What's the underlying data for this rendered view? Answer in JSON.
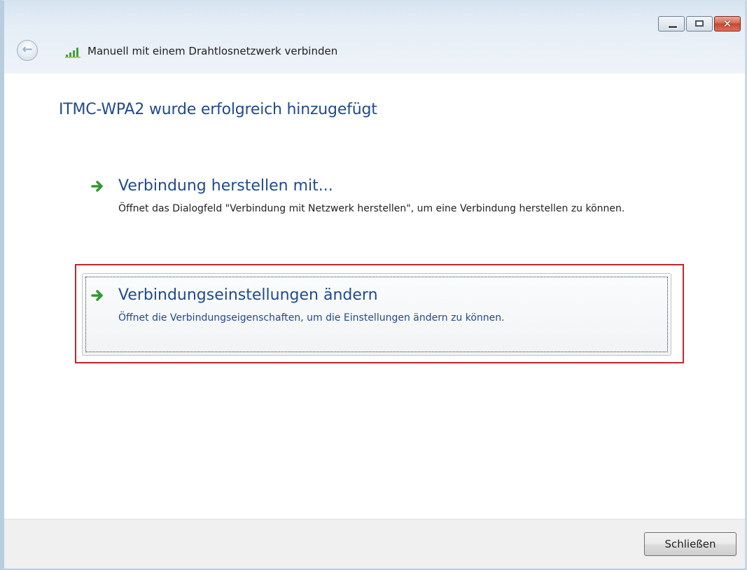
{
  "window": {
    "title": "Manuell mit einem Drahtlosnetzwerk verbinden",
    "controls": {
      "minimize_icon": "minimize-icon",
      "maximize_icon": "maximize-icon",
      "close_glyph": "✕"
    }
  },
  "nav": {
    "back_glyph": "←"
  },
  "main": {
    "heading": "ITMC-WPA2 wurde erfolgreich hinzugefügt",
    "options": [
      {
        "title": "Verbindung herstellen mit...",
        "description": "Öffnet das Dialogfeld \"Verbindung mit Netzwerk herstellen\", um eine Verbindung herstellen zu können.",
        "icon": "green-arrow-icon"
      },
      {
        "title": "Verbindungseinstellungen ändern",
        "description": "Öffnet die Verbindungseigenschaften, um die Einstellungen ändern zu können.",
        "icon": "green-arrow-icon",
        "highlighted": true
      }
    ]
  },
  "footer": {
    "close_label": "Schließen"
  },
  "colors": {
    "link_blue": "#1f4b8e",
    "highlight_red": "#c0272d",
    "arrow_green": "#2e9a2e"
  }
}
